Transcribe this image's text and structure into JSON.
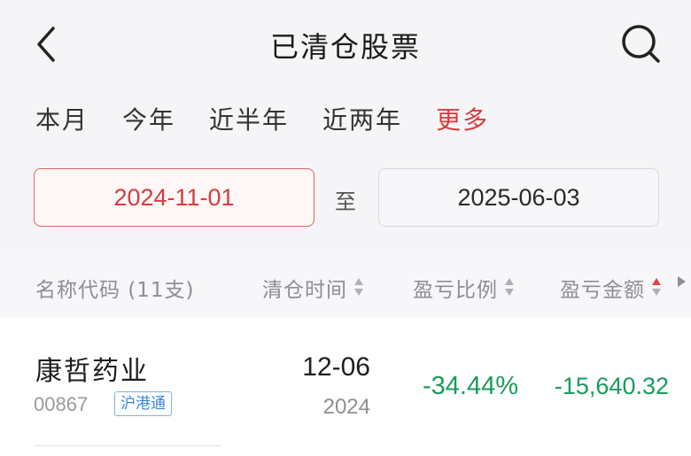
{
  "header": {
    "title": "已清仓股票",
    "back_icon": "chevron-left-icon",
    "search_icon": "search-icon"
  },
  "tabs": [
    {
      "label": "本月",
      "active": false
    },
    {
      "label": "今年",
      "active": false
    },
    {
      "label": "近半年",
      "active": false
    },
    {
      "label": "近两年",
      "active": false
    },
    {
      "label": "更多",
      "active": true
    }
  ],
  "date_range": {
    "start": "2024-11-01",
    "separator": "至",
    "end": "2025-06-03"
  },
  "columns": {
    "name": "名称代码 (11支)",
    "date": "清仓时间",
    "ratio": "盈亏比例",
    "amount": "盈亏金额"
  },
  "rows": [
    {
      "name": "康哲药业",
      "code": "00867",
      "tag": "沪港通",
      "date": "12-06",
      "year": "2024",
      "ratio": "-34.44%",
      "amount": "-15,640.32"
    }
  ],
  "colors": {
    "accent_red": "#d83a3a",
    "loss_green": "#1a9b5a",
    "tag_blue": "#3a86d6"
  }
}
